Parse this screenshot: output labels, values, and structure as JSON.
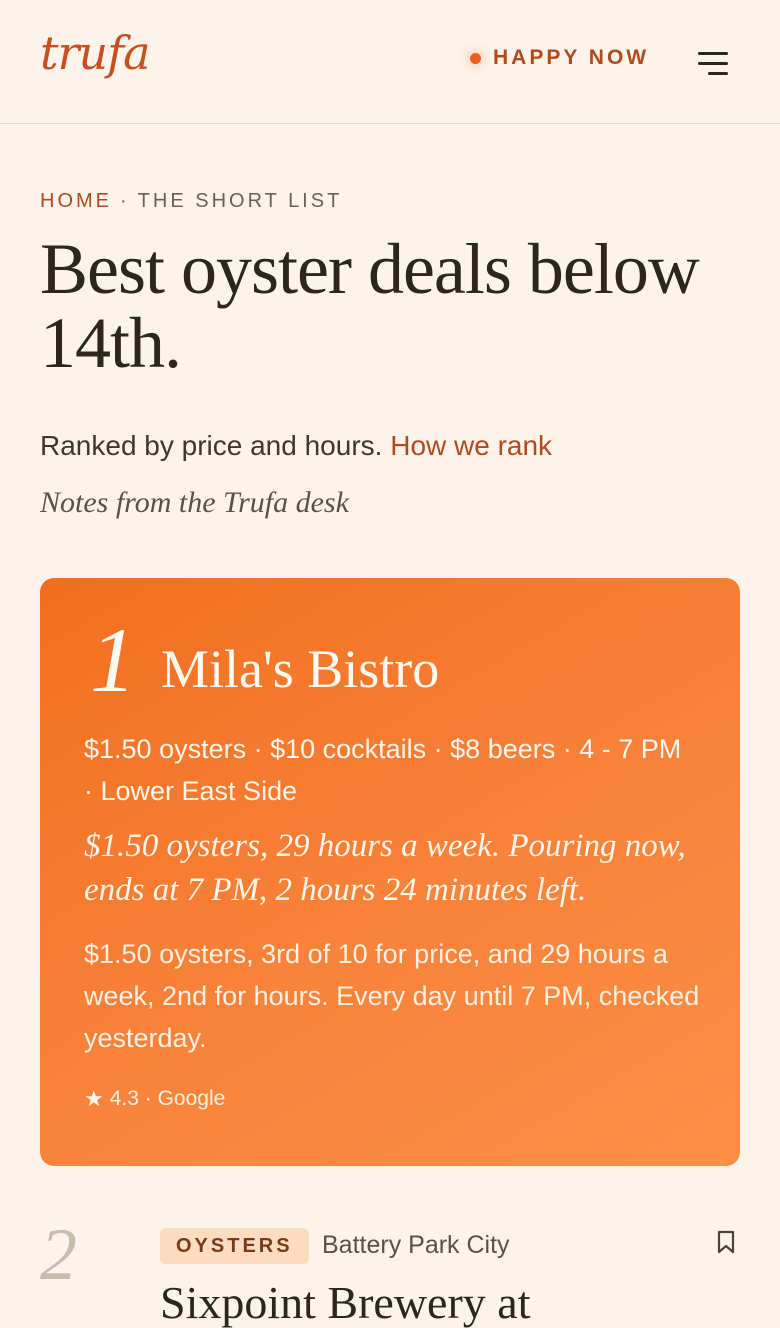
{
  "header": {
    "logo": "trufa",
    "status_label": "HAPPY NOW",
    "status_color": "#e85d22"
  },
  "breadcrumb": {
    "home": "HOME",
    "separator": "·",
    "current": "THE SHORT LIST"
  },
  "page": {
    "title": "Best oyster deals below 14th.",
    "subtitle": "Ranked by price and hours.",
    "subtitle_link": "How we rank",
    "desk_note": "Notes from the Trufa desk"
  },
  "featured": {
    "rank": "1",
    "name": "Mila's Bistro",
    "meta": "$1.50 oysters · $10 cocktails · $8 beers · 4 - 7 PM · Lower East Side",
    "quote": "$1.50 oysters, 29 hours a week. Pouring now, ends at 7 PM, 2 hours 24 minutes left.",
    "detail": "$1.50 oysters, 3rd of 10 for price, and 29 hours a week, 2nd for hours. Every day until 7 PM, checked yesterday.",
    "rating_icon": "star-icon",
    "rating": "4.3 · Google",
    "accent_color": "#f26e1e"
  },
  "next_item": {
    "rank": "2",
    "tag": "OYSTERS",
    "area": "Battery Park City",
    "name": "Sixpoint Brewery at",
    "bookmark_icon": "bookmark-icon"
  }
}
